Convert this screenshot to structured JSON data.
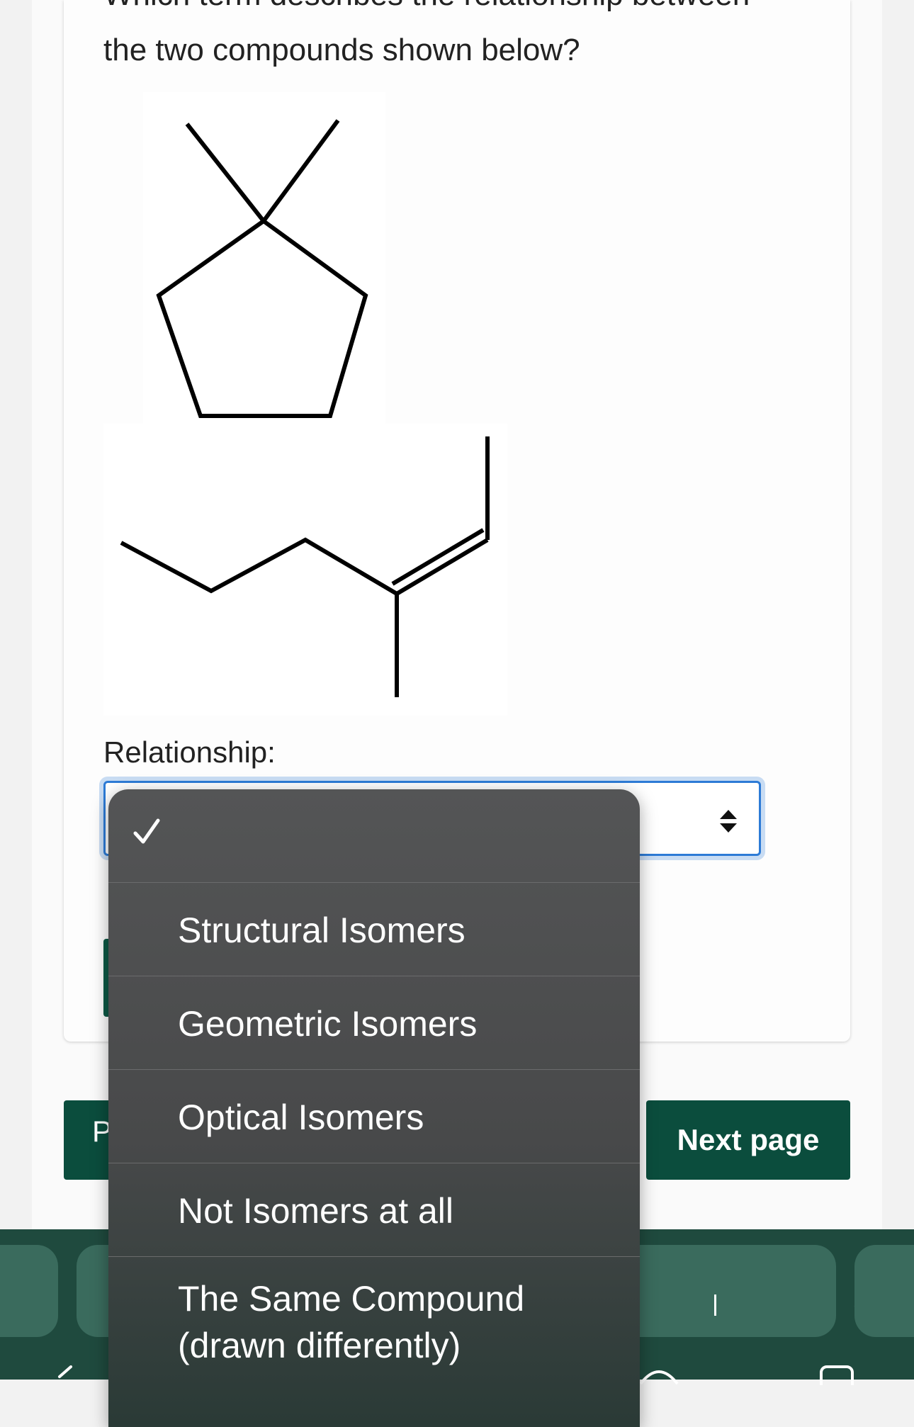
{
  "question": {
    "line1": "Which term describes the relationship between",
    "line2": "the two compounds shown below?"
  },
  "relationship_label": "Relationship:",
  "dropdown": {
    "options": [
      "",
      "Structural Isomers",
      "Geometric Isomers",
      "Optical Isomers",
      "Not Isomers at all",
      "The Same Compound (drawn differently)"
    ],
    "option_lines": {
      "same_compound_line1": "The Same Compound",
      "same_compound_line2": "(drawn differently)"
    },
    "selected_index": 0
  },
  "nav": {
    "prev_label": "P",
    "next_label": "Next page"
  },
  "colors": {
    "button_green": "#0b4d3d",
    "toolbar": "#1f4a3e",
    "focus_blue": "#2d7bd6"
  }
}
